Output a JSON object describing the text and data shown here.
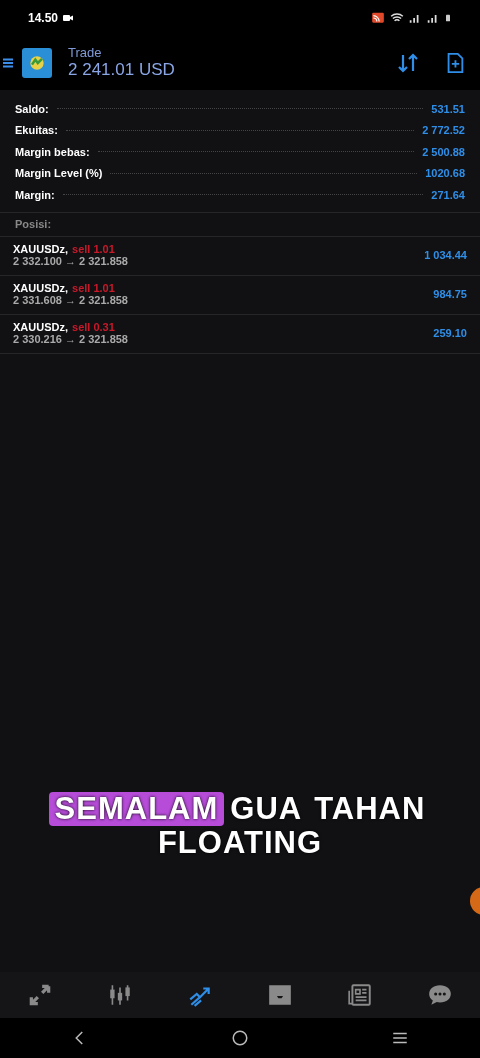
{
  "status_bar": {
    "time": "14.50"
  },
  "header": {
    "title": "Trade",
    "balance": "2 241.01 USD"
  },
  "summary": [
    {
      "label": "Saldo:",
      "value": "531.51"
    },
    {
      "label": "Ekuitas:",
      "value": "2 772.52"
    },
    {
      "label": "Margin bebas:",
      "value": "2 500.88"
    },
    {
      "label": "Margin Level (%)",
      "value": "1020.68"
    },
    {
      "label": "Margin:",
      "value": "271.64"
    }
  ],
  "positions_header": "Posisi:",
  "positions": [
    {
      "symbol": "XAUUSDz,",
      "order": "sell 1.01",
      "prices": "2 332.100 → 2 321.858",
      "profit": "1 034.44"
    },
    {
      "symbol": "XAUUSDz,",
      "order": "sell 1.01",
      "prices": "2 331.608 → 2 321.858",
      "profit": "984.75"
    },
    {
      "symbol": "XAUUSDz,",
      "order": "sell 0.31",
      "prices": "2 330.216 → 2 321.858",
      "profit": "259.10"
    }
  ],
  "caption": {
    "lines": [
      [
        {
          "text": "SEMALAM",
          "highlighted": true
        },
        {
          "text": "GUA",
          "highlighted": false
        },
        {
          "text": "TAHAN",
          "highlighted": false
        }
      ],
      [
        {
          "text": "FLOATING",
          "highlighted": false
        }
      ]
    ]
  },
  "bottom_nav": [
    {
      "kind": "quotes",
      "selected": false
    },
    {
      "kind": "chart",
      "selected": false
    },
    {
      "kind": "trade",
      "selected": true
    },
    {
      "kind": "history",
      "selected": false
    },
    {
      "kind": "news",
      "selected": false
    },
    {
      "kind": "messages",
      "selected": false
    }
  ]
}
